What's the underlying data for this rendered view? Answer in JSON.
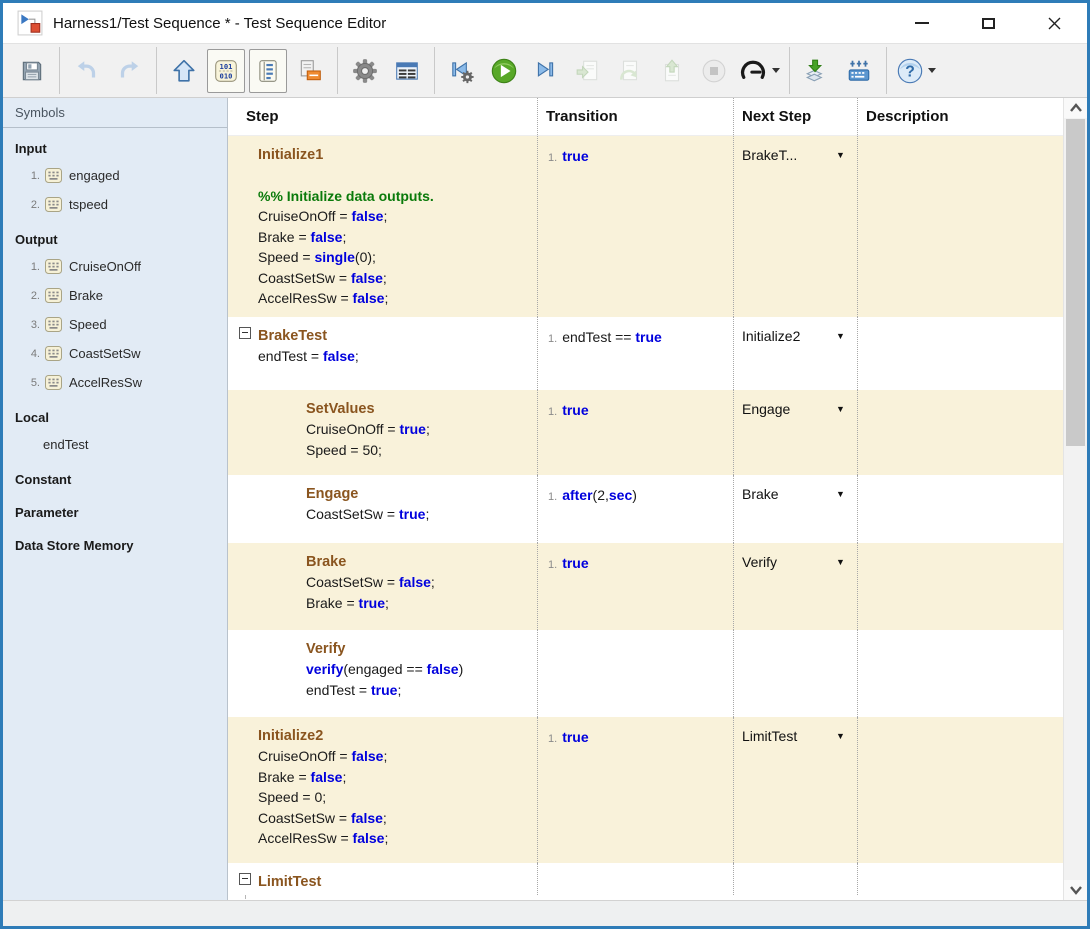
{
  "window": {
    "title": "Harness1/Test Sequence * - Test Sequence Editor"
  },
  "colors": {
    "row_highlight": "#f9f2da",
    "keyword_blue": "#0000dd",
    "comment_green": "#0a7a0a",
    "step_name_brown": "#8a551f",
    "sidebar_bg": "#e2ebf5",
    "window_border_blue": "#2e7cb8"
  },
  "toolbar": {
    "glyphs": {
      "binary_top": "101",
      "binary_bottom": "010",
      "help": "?"
    },
    "buttons": [
      {
        "name": "save",
        "enabled": true
      },
      {
        "name": "undo",
        "enabled": false,
        "sep_before": true
      },
      {
        "name": "redo",
        "enabled": false
      },
      {
        "name": "go-to-parent",
        "enabled": true,
        "sep_before": true
      },
      {
        "name": "symbols-pane-toggle",
        "enabled": true,
        "pressed": true
      },
      {
        "name": "description-pane-toggle",
        "enabled": true,
        "pressed": true
      },
      {
        "name": "requirements",
        "enabled": true
      },
      {
        "name": "settings",
        "enabled": true,
        "sep_before": true
      },
      {
        "name": "table-format",
        "enabled": true
      },
      {
        "name": "step-back",
        "enabled": true,
        "sep_before": true
      },
      {
        "name": "run",
        "enabled": true
      },
      {
        "name": "step-forward",
        "enabled": true
      },
      {
        "name": "step-in",
        "enabled": false
      },
      {
        "name": "step-over",
        "enabled": false
      },
      {
        "name": "step-out",
        "enabled": false
      },
      {
        "name": "stop",
        "enabled": false
      },
      {
        "name": "simulation-pacing",
        "enabled": true,
        "dropdown": true
      },
      {
        "name": "add-iteration",
        "enabled": true,
        "sep_before": true
      },
      {
        "name": "add-symbol",
        "enabled": true
      },
      {
        "name": "help",
        "enabled": true,
        "dropdown": true,
        "sep_before": true
      }
    ]
  },
  "sidebar": {
    "title": "Symbols",
    "sections": [
      {
        "label": "Input",
        "items": [
          {
            "num": "1.",
            "label": "engaged",
            "icon": true
          },
          {
            "num": "2.",
            "label": "tspeed",
            "icon": true
          }
        ]
      },
      {
        "label": "Output",
        "items": [
          {
            "num": "1.",
            "label": "CruiseOnOff",
            "icon": true
          },
          {
            "num": "2.",
            "label": "Brake",
            "icon": true
          },
          {
            "num": "3.",
            "label": "Speed",
            "icon": true
          },
          {
            "num": "4.",
            "label": "CoastSetSw",
            "icon": true
          },
          {
            "num": "5.",
            "label": "AccelResSw",
            "icon": true
          }
        ]
      },
      {
        "label": "Local",
        "items": [
          {
            "num": "",
            "label": "endTest",
            "icon": false
          }
        ]
      },
      {
        "label": "Constant",
        "items": []
      },
      {
        "label": "Parameter",
        "items": []
      },
      {
        "label": "Data Store Memory",
        "items": []
      }
    ]
  },
  "table": {
    "columns": [
      "Step",
      "Transition",
      "Next Step",
      "Description"
    ],
    "rows": [
      {
        "name": "Initialize1",
        "indent": false,
        "expander": false,
        "bg": "beige",
        "body": [
          [],
          [
            [
              "%% Initialize data outputs.",
              "comment"
            ]
          ],
          [
            [
              "CruiseOnOff = ",
              "plain"
            ],
            [
              "false",
              "kw"
            ],
            [
              ";",
              "plain"
            ]
          ],
          [
            [
              "Brake = ",
              "plain"
            ],
            [
              "false",
              "kw"
            ],
            [
              ";",
              "plain"
            ]
          ],
          [
            [
              "Speed = ",
              "plain"
            ],
            [
              "single",
              "kw"
            ],
            [
              "(0);",
              "plain"
            ]
          ],
          [
            [
              "CoastSetSw = ",
              "plain"
            ],
            [
              "false",
              "kw"
            ],
            [
              ";",
              "plain"
            ]
          ],
          [
            [
              "AccelResSw = ",
              "plain"
            ],
            [
              "false",
              "kw"
            ],
            [
              ";",
              "plain"
            ]
          ]
        ],
        "transition": {
          "num": "1.",
          "tokens": [
            [
              "true",
              "kw"
            ]
          ]
        },
        "next": {
          "label": "BrakeT...",
          "arrow": "▼"
        }
      },
      {
        "name": "BrakeTest",
        "indent": false,
        "expander": true,
        "bg": "white",
        "body": [
          [
            [
              "endTest = ",
              "plain"
            ],
            [
              "false",
              "kw"
            ],
            [
              ";",
              "plain"
            ]
          ]
        ],
        "transition": {
          "num": "1.",
          "tokens": [
            [
              "endTest == ",
              "plain"
            ],
            [
              "true",
              "kw"
            ]
          ]
        },
        "next": {
          "label": "Initialize2",
          "arrow": "▼"
        }
      },
      {
        "name": "SetValues",
        "indent": true,
        "expander": false,
        "bg": "beige",
        "body": [
          [
            [
              "CruiseOnOff = ",
              "plain"
            ],
            [
              "true",
              "kw"
            ],
            [
              ";",
              "plain"
            ]
          ],
          [
            [
              "Speed = 50;",
              "plain"
            ]
          ]
        ],
        "transition": {
          "num": "1.",
          "tokens": [
            [
              "true",
              "kw"
            ]
          ]
        },
        "next": {
          "label": "Engage",
          "arrow": "▼"
        }
      },
      {
        "name": "Engage",
        "indent": true,
        "expander": false,
        "bg": "white",
        "body": [
          [
            [
              "CoastSetSw = ",
              "plain"
            ],
            [
              "true",
              "kw"
            ],
            [
              ";",
              "plain"
            ]
          ]
        ],
        "transition": {
          "num": "1.",
          "tokens": [
            [
              "after",
              "kw"
            ],
            [
              "(2,",
              "plain"
            ],
            [
              "sec",
              "kw"
            ],
            [
              ")",
              "plain"
            ]
          ]
        },
        "next": {
          "label": "Brake",
          "arrow": "▼"
        }
      },
      {
        "name": "Brake",
        "indent": true,
        "expander": false,
        "bg": "beige",
        "body": [
          [
            [
              "CoastSetSw = ",
              "plain"
            ],
            [
              "false",
              "kw"
            ],
            [
              ";",
              "plain"
            ]
          ],
          [
            [
              "Brake = ",
              "plain"
            ],
            [
              "true",
              "kw"
            ],
            [
              ";",
              "plain"
            ]
          ]
        ],
        "transition": {
          "num": "1.",
          "tokens": [
            [
              "true",
              "kw"
            ]
          ]
        },
        "next": {
          "label": "Verify",
          "arrow": "▼"
        }
      },
      {
        "name": "Verify",
        "indent": true,
        "expander": false,
        "bg": "white",
        "body": [
          [
            [
              "verify",
              "kw"
            ],
            [
              "(engaged == ",
              "plain"
            ],
            [
              "false",
              "kw"
            ],
            [
              ")",
              "plain"
            ]
          ],
          [
            [
              "endTest = ",
              "plain"
            ],
            [
              "true",
              "kw"
            ],
            [
              ";",
              "plain"
            ]
          ]
        ],
        "transition": null,
        "next": null
      },
      {
        "name": "Initialize2",
        "indent": false,
        "expander": false,
        "bg": "beige",
        "body": [
          [
            [
              "CruiseOnOff = ",
              "plain"
            ],
            [
              "false",
              "kw"
            ],
            [
              ";",
              "plain"
            ]
          ],
          [
            [
              "Brake = ",
              "plain"
            ],
            [
              "false",
              "kw"
            ],
            [
              ";",
              "plain"
            ]
          ],
          [
            [
              "Speed = 0;",
              "plain"
            ]
          ],
          [
            [
              "CoastSetSw = ",
              "plain"
            ],
            [
              "false",
              "kw"
            ],
            [
              ";",
              "plain"
            ]
          ],
          [
            [
              "AccelResSw = ",
              "plain"
            ],
            [
              "false",
              "kw"
            ],
            [
              ";",
              "plain"
            ]
          ]
        ],
        "transition": {
          "num": "1.",
          "tokens": [
            [
              "true",
              "kw"
            ]
          ]
        },
        "next": {
          "label": "LimitTest",
          "arrow": "▼"
        }
      },
      {
        "name": "LimitTest",
        "indent": false,
        "expander": true,
        "bg": "white",
        "body": [],
        "transition": null,
        "next": null
      }
    ]
  }
}
